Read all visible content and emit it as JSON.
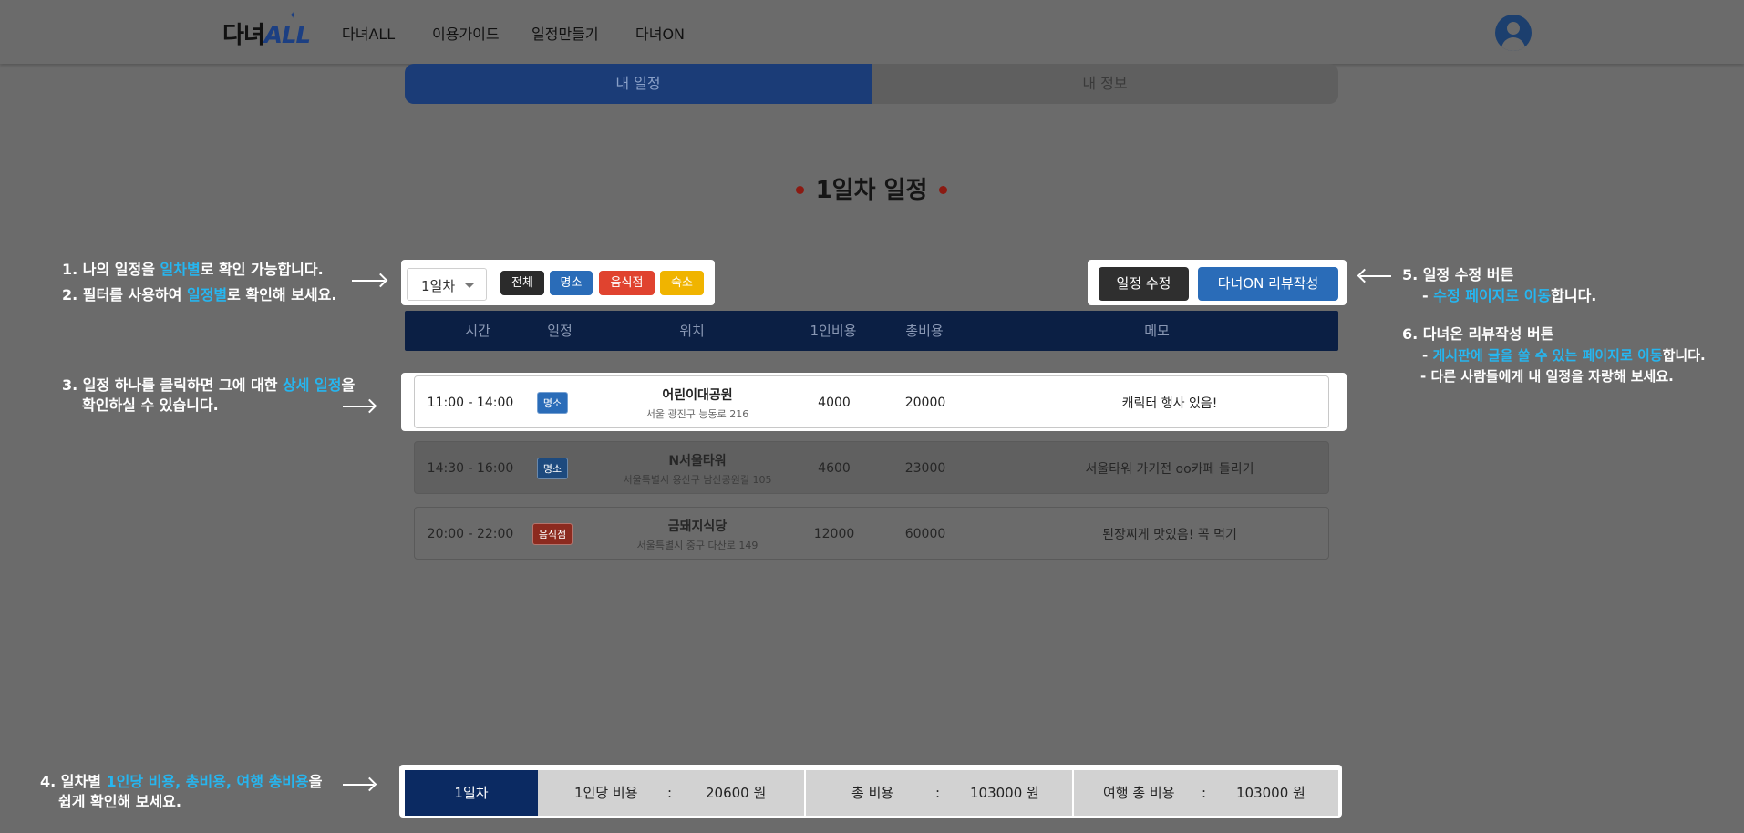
{
  "header": {
    "logo_main": "다녀",
    "logo_accent": "ALL",
    "nav": [
      "다녀ALL",
      "이용가이드",
      "일정만들기",
      "다녀ON"
    ]
  },
  "tabs": {
    "my_schedule": "내 일정",
    "my_info": "내 정보"
  },
  "day_title": "1일차 일정",
  "filter": {
    "day_select": "1일차",
    "chips": [
      "전체",
      "명소",
      "음식점",
      "숙소"
    ]
  },
  "actions": {
    "edit": "일정 수정",
    "review": "다녀ON 리뷰작성"
  },
  "table": {
    "headers": [
      "시간",
      "일정",
      "위치",
      "1인비용",
      "총비용",
      "메모"
    ],
    "rows": [
      {
        "time": "11:00 - 14:00",
        "tag": "명소",
        "place": "어린이대공원",
        "address": "서울 광진구 능동로 216",
        "per_person": "4000",
        "total": "20000",
        "memo": "캐릭터 행사 있음!"
      },
      {
        "time": "14:30 - 16:00",
        "tag": "명소",
        "place": "N서울타워",
        "address": "서울특별시 용산구 남산공원길 105",
        "per_person": "4600",
        "total": "23000",
        "memo": "서울타워 가기전 oo카페 들리기"
      },
      {
        "time": "20:00 - 22:00",
        "tag": "음식점",
        "place": "금돼지식당",
        "address": "서울특별시 중구 다산로 149",
        "per_person": "12000",
        "total": "60000",
        "memo": "된장찌게 맛있음! 꼭 먹기"
      }
    ]
  },
  "summary": {
    "day": "1일차",
    "per_person_label": "1인당 비용",
    "per_person_value": "20600 원",
    "total_label": "총 비용",
    "total_value": "103000 원",
    "trip_total_label": "여행 총 비용",
    "trip_total_value": "103000 원",
    "colon": ":"
  },
  "annotations": {
    "a1_pre": "1. 나의 일정을 ",
    "a1_hl": "일차별",
    "a1_post": "로 확인 가능합니다.",
    "a2_pre": "2. 필터를 사용하여 ",
    "a2_hl": "일정별",
    "a2_post": "로 확인해 보세요.",
    "a3_pre": "3. 일정 하나를 클릭하면  그에 대한  ",
    "a3_hl": "상세 일정",
    "a3_post": "을",
    "a3_line2": "확인하실 수 있습니다.",
    "a4_pre": "4. 일차별 ",
    "a4_hl": "1인당 비용, 총비용, 여행 총비용",
    "a4_post": "을",
    "a4_line2": "쉽게 확인해 보세요.",
    "a5_line1": "5. 일정 수정 버튼",
    "a5_pre": "- ",
    "a5_hl": "수정 페이지로 이동",
    "a5_post": "합니다.",
    "a6_line1": "6. 다녀온 리뷰작성 버튼",
    "a6_pre": "- ",
    "a6_hl": "게시판에 글을 쓸 수 있는 페이지로 이동",
    "a6_post": "합니다.",
    "a6_line3": "-  다른 사람들에게 내 일정을 자랑해 보세요."
  },
  "colors": {
    "overlay": "#6b6b6b",
    "navy": "#0b1f44",
    "primary": "#1b3c77",
    "highlight": "#26b6f0",
    "chip_all": "#2b2b2b",
    "chip_sight": "#2a6cb8",
    "chip_food": "#e0432f",
    "chip_stay": "#f0b400",
    "btn_edit": "#2f2f2f",
    "btn_review": "#2a6cb8"
  }
}
